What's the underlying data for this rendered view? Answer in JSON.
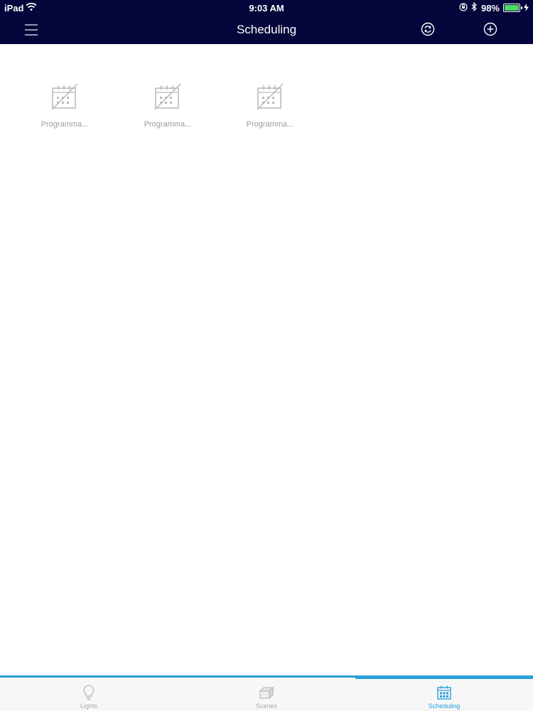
{
  "status_bar": {
    "carrier": "iPad",
    "time": "9:03 AM",
    "battery_percent": "98%",
    "battery_level": 0.98
  },
  "nav": {
    "title": "Scheduling",
    "left_icon": "menu-icon",
    "right_icons": [
      "sync-icon",
      "add-icon"
    ]
  },
  "schedules": [
    {
      "label": "Programma...",
      "icon": "calendar-disabled-icon"
    },
    {
      "label": "Programma...",
      "icon": "calendar-disabled-icon"
    },
    {
      "label": "Programma...",
      "icon": "calendar-disabled-icon"
    }
  ],
  "tabs": [
    {
      "label": "Lights",
      "icon": "bulb-icon",
      "active": false
    },
    {
      "label": "Scenes",
      "icon": "scenes-icon",
      "active": false
    },
    {
      "label": "Scheduling",
      "icon": "calendar-icon",
      "active": true
    }
  ],
  "colors": {
    "header_bg": "#04053a",
    "accent": "#2a9fd8",
    "inactive": "#a8a8a8"
  }
}
